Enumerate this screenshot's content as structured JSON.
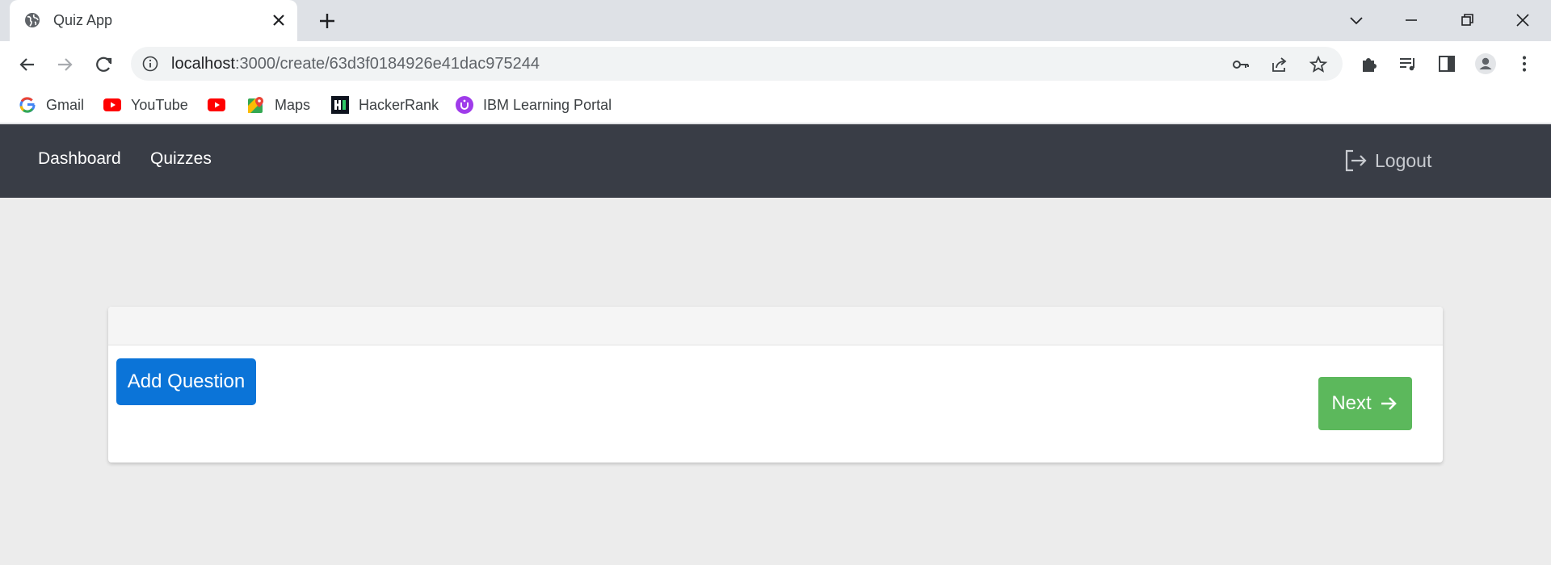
{
  "browser": {
    "tab": {
      "title": "Quiz App",
      "icon": "globe-icon"
    },
    "address": {
      "host": "localhost",
      "path": ":3000/create/63d3f0184926e41dac975244"
    },
    "bookmarks": [
      {
        "label": "Gmail",
        "icon": "google-icon"
      },
      {
        "label": "YouTube",
        "icon": "youtube-icon"
      },
      {
        "label": "",
        "icon": "youtube-icon"
      },
      {
        "label": "Maps",
        "icon": "maps-icon"
      },
      {
        "label": "HackerRank",
        "icon": "hackerrank-icon"
      },
      {
        "label": "IBM Learning Portal",
        "icon": "ibm-learning-icon"
      }
    ]
  },
  "app": {
    "nav": {
      "dashboard": "Dashboard",
      "quizzes": "Quizzes",
      "logout": "Logout"
    },
    "card": {
      "add_question": "Add Question",
      "next": "Next"
    }
  },
  "colors": {
    "navbar": "#393d46",
    "primary": "#0b74d8",
    "success": "#5cb85c",
    "page_bg": "#ececec"
  }
}
